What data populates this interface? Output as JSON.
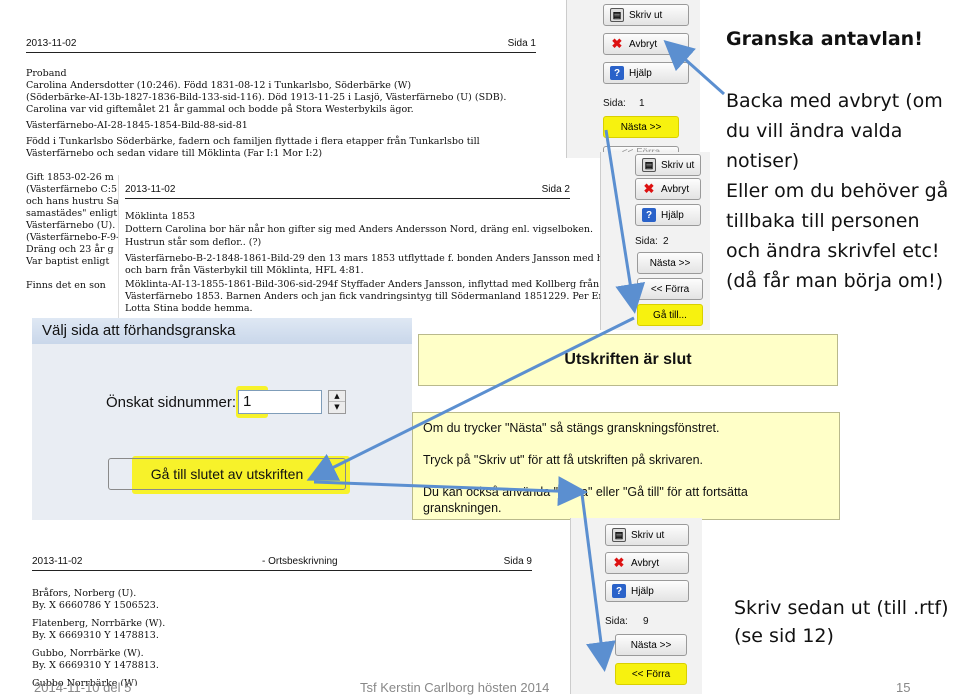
{
  "page1": {
    "date": "2013-11-02",
    "sida": "Sida 1",
    "lines": [
      "Proband",
      "Carolina   Andersdotter  (10:246).  Född  1831-08-12  i  Tunkarlsbo,  Söderbärke  (W)",
      "(Söderbärke-AI-13b-1827-1836-Bild-133-sid-116).     Död  1913-11-25  i  Lasjö,  Västerfärnebo  (U)  (SDB).",
      "Carolina  var vid giftemålet  21  år gammal och bodde på Stora  Westerbykils  ägor.",
      "   Västerfärnebo-AI-28-1845-1854-Bild-88-sid-81",
      "  Född  i  Tunkarlsbo  Söderbärke,   fadern  och  familjen  flyttade  i  flera  etapper  från  Tunkarlsbo   till",
      "Västerfärnebo   och  sedan vidare till  Möklinta   (Far  I:1   Mor  I:2)"
    ],
    "left_lines": [
      "Gift  1853-02-26   m",
      "(Västerfärnebo  C:5",
      "och  hans hustru  Sa",
      "samastädes\"  enligt",
      "Västerfärnebo  (U).",
      "(Västerfärnebo-F-9-",
      "Dräng  och 23 år g",
      "Var  baptist  enligt",
      "",
      "Finns   det  en  son"
    ]
  },
  "page2": {
    "date": "2013-11-02",
    "sida": "Sida 2",
    "lines": [
      "Möklinta   1853",
      "   Dottern  Carolina  bor  här  når  hon  gifter  sig  med  Anders  Andersson  Nord,  dräng  enl.  vigselboken.",
      "   Hustrun  står  som  deflor..  (?)",
      "   Västerfärnebo-B-2-1848-1861-Bild-29       den  13  mars  1853  utflyttade  f.  bonden  Anders  Jansson  med  hustru",
      "och  barn  från  Västerbykil  till  Möklinta,   HFL  4:81.",
      "   Möklinta-AI-13-1855-1861-Bild-306-sid-294f       Styffader  Anders  Jansson,  inflyttad  med  Kollberg  från",
      "Västerfärnebo   1853.  Barnen  Anders  och  jan  fick  vandringsintyg   till  Södermanland   1851229.   Per  Erik  och",
      "Lotta   Stina   bodde   hemma."
    ]
  },
  "page9": {
    "date": "2013-11-02",
    "center": "- Ortsbeskrivning",
    "sida": "Sida 9",
    "lines": [
      "Bråfors,  Norberg  (U).",
      "   By.  X  6660786   Y  1506523.",
      "Flatenberg,  Norrbärke  (W).",
      "   By.  X  6669310   Y  1478813.",
      "Gubbo,  Norrbärke  (W).",
      "   By.  X  6669310   Y  1478813.",
      "Gubbo  Norrbärke  (W)"
    ]
  },
  "panel1": {
    "print": "Skriv ut",
    "cancel": "Avbryt",
    "help": "Hjälp",
    "sida_label": "Sida:",
    "sida_value": "1",
    "next": "Nästa >>",
    "prev": "<< Förra"
  },
  "panel2": {
    "print": "Skriv ut",
    "cancel": "Avbryt",
    "help": "Hjälp",
    "sida_label": "Sida:",
    "sida_value": "2",
    "next": "Nästa >>",
    "prev": "<< Förra",
    "goto": "Gå till..."
  },
  "panel3": {
    "print": "Skriv ut",
    "cancel": "Avbryt",
    "help": "Hjälp",
    "sida_label": "Sida:",
    "sida_value": "9",
    "next": "Nästa >>",
    "prev": "<< Förra"
  },
  "dialog": {
    "title": "Välj sida att förhandsgranska",
    "page_label": "Önskat sidnummer:",
    "page_value": "1",
    "goto_end_button": "Gå till slutet av utskriften"
  },
  "end_box": {
    "title": "Utskriften är slut"
  },
  "info_box": {
    "line1": "Om du trycker \"Nästa\" så stängs granskningsfönstret.",
    "line2": "Tryck på \"Skriv ut\" för att få utskriften på skrivaren.",
    "line3": "Du kan också använda \"Förra\" eller \"Gå till\" för att fortsätta",
    "line4": "granskningen."
  },
  "notes": {
    "heading": "Granska antavlan!",
    "text_lines": [
      "Backa med avbryt (om",
      "du vill ändra valda",
      "notiser)",
      "Eller om du behöver gå",
      "tillbaka till personen",
      "och ändra skrivfel etc!",
      "(då får man börja om!)"
    ],
    "bottom_lines": [
      "Skriv sedan ut (till .rtf)",
      "(se sid 12)"
    ]
  },
  "footer": {
    "left": "2014-11-10 del 5",
    "center": "Tsf Kerstin Carlborg hösten 2014",
    "page": "15"
  },
  "colors": {
    "highlight": "#f7f20f",
    "arrow": "#5b8fd0",
    "note_box": "#ffffc8"
  }
}
